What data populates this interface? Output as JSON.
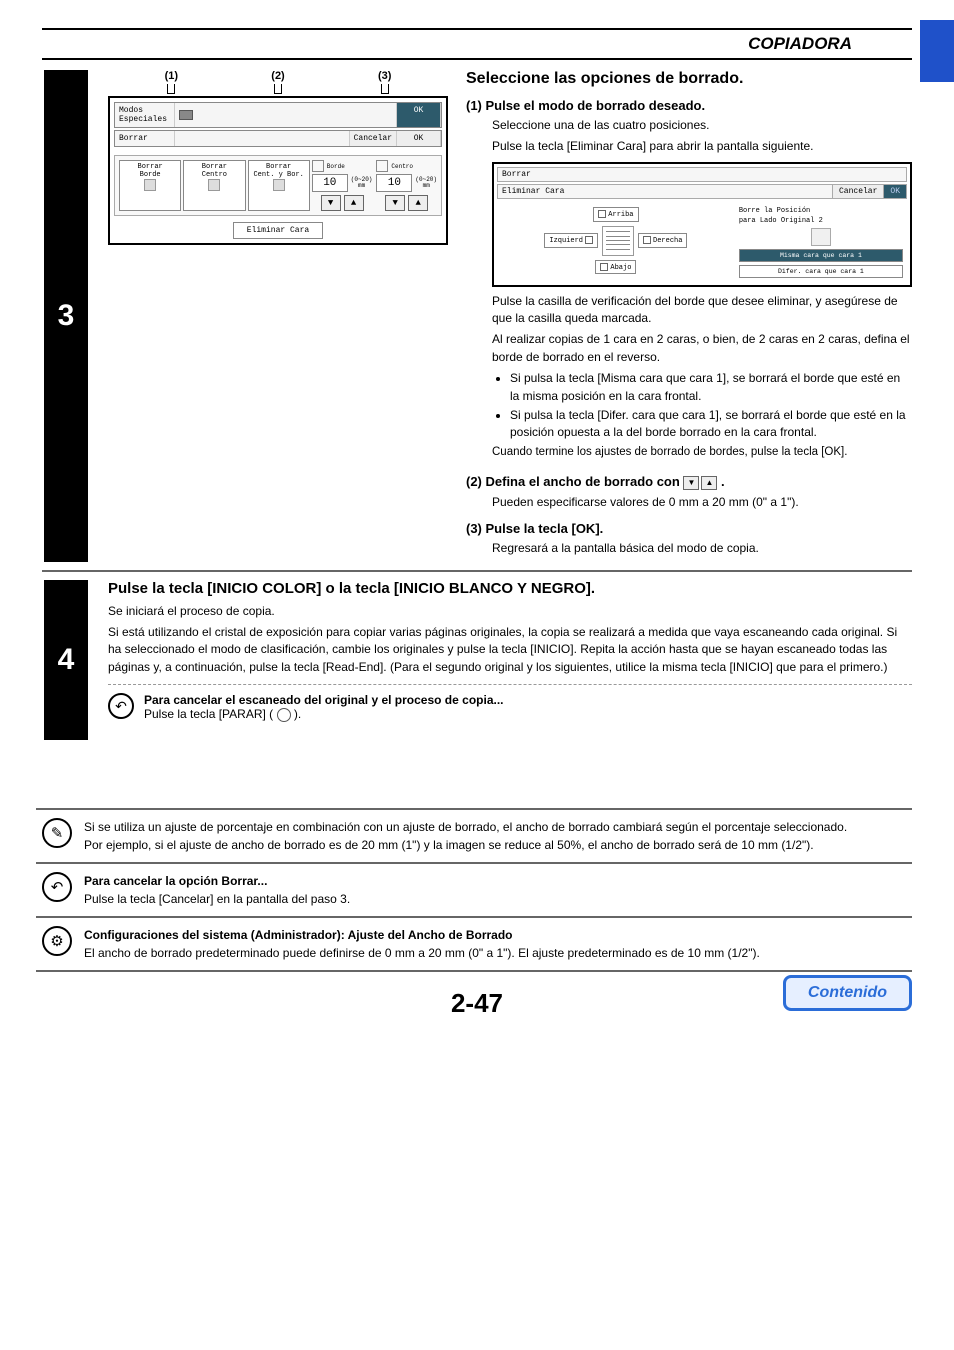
{
  "header": {
    "title": "COPIADORA"
  },
  "step3": {
    "number": "3",
    "callouts": {
      "c1": "(1)",
      "c2": "(2)",
      "c3": "(3)"
    },
    "panel1": {
      "row_modos": "Modos Especiales",
      "row_ok_small": "OK",
      "row_borrar": "Borrar",
      "btn_cancelar": "Cancelar",
      "btn_ok": "OK",
      "opts": [
        {
          "line1": "Borrar",
          "line2": "Borde"
        },
        {
          "line1": "Borrar",
          "line2": "Centro"
        },
        {
          "line1": "Borrar",
          "line2": "Cent. y Bor."
        }
      ],
      "borde_label": "Borde",
      "centro_label": "Centro",
      "spin1": "10",
      "spin2": "10",
      "range": "(0~20)",
      "unit": "mm",
      "eliminar_cara": "Eliminar Cara"
    },
    "right": {
      "h2": "Seleccione las opciones de borrado.",
      "s1": {
        "h": "(1) Pulse el modo de borrado deseado.",
        "p1": "Seleccione una de las cuatro posiciones.",
        "p2": "Pulse la tecla [Eliminar Cara] para abrir la pantalla siguiente."
      },
      "panel2": {
        "top": "Borrar",
        "left": "Eliminar Cara",
        "btn_cancelar": "Cancelar",
        "btn_ok": "OK",
        "arriba": "Arriba",
        "izquierd": "Izquierd",
        "derecha": "Derecha",
        "abajo": "Abajo",
        "rt1": "Borre la Posición",
        "rt2": "para Lado Original 2",
        "rb1": "Misma cara que cara 1",
        "rb2": "Difer. cara que cara 1"
      },
      "after_panel": {
        "p1": "Pulse la casilla de verificación del borde que desee eliminar, y asegúrese de que la casilla queda marcada.",
        "p2": "Al realizar copias de 1 cara en 2 caras, o bien, de 2 caras en 2 caras, defina el borde de borrado en el reverso.",
        "b1": "Si pulsa la tecla [Misma cara que cara 1], se borrará el borde que esté en la misma posición en la cara frontal.",
        "b2": "Si pulsa la tecla [Difer. cara que cara 1], se borrará el borde que esté en la posición opuesta a la del borde borrado en la cara frontal.",
        "p3": "Cuando termine los ajustes de borrado de bordes, pulse la tecla [OK]."
      },
      "s2": {
        "h_pre": "(2) Defina el ancho de borrado con ",
        "h_post": ".",
        "p": "Pueden especificarse valores de 0 mm a 20 mm (0\" a 1\")."
      },
      "s3": {
        "h": "(3) Pulse la tecla [OK].",
        "p": "Regresará a la pantalla básica del modo de copia."
      }
    }
  },
  "step4": {
    "number": "4",
    "h": "Pulse la tecla [INICIO COLOR] o la tecla [INICIO BLANCO Y NEGRO].",
    "p1": "Se iniciará el proceso de copia.",
    "p2": "Si está utilizando el cristal de exposición para copiar varias páginas originales, la copia se realizará a medida que vaya escaneando cada original. Si ha seleccionado el modo de clasificación, cambie los originales y pulse la tecla [INICIO]. Repita la acción hasta que se hayan escaneado todas las páginas y, a continuación, pulse la tecla [Read-End]. (Para el segundo original y los siguientes, utilice la misma tecla [INICIO] que para el primero.)",
    "note_h": "Para cancelar el escaneado del original y el proceso de copia...",
    "note_p_pre": "Pulse la tecla [PARAR] (",
    "note_p_post": ")."
  },
  "info1": {
    "p1": "Si se utiliza un ajuste de porcentaje en combinación con un ajuste de borrado, el ancho de borrado cambiará según el porcentaje seleccionado.",
    "p2": "Por ejemplo, si el ajuste de ancho de borrado es de 20 mm (1\") y la imagen se reduce al 50%, el ancho de borrado será de 10 mm (1/2\")."
  },
  "info2": {
    "h": "Para cancelar la opción Borrar...",
    "p": "Pulse la tecla [Cancelar] en la pantalla del paso 3."
  },
  "info3": {
    "h": "Configuraciones del sistema (Administrador): Ajuste del Ancho de Borrado",
    "p": "El ancho de borrado predeterminado puede definirse de 0 mm a 20 mm (0\" a 1\"). El ajuste predeterminado es de 10 mm (1/2\")."
  },
  "page_num": "2-47",
  "toc": "Contenido"
}
